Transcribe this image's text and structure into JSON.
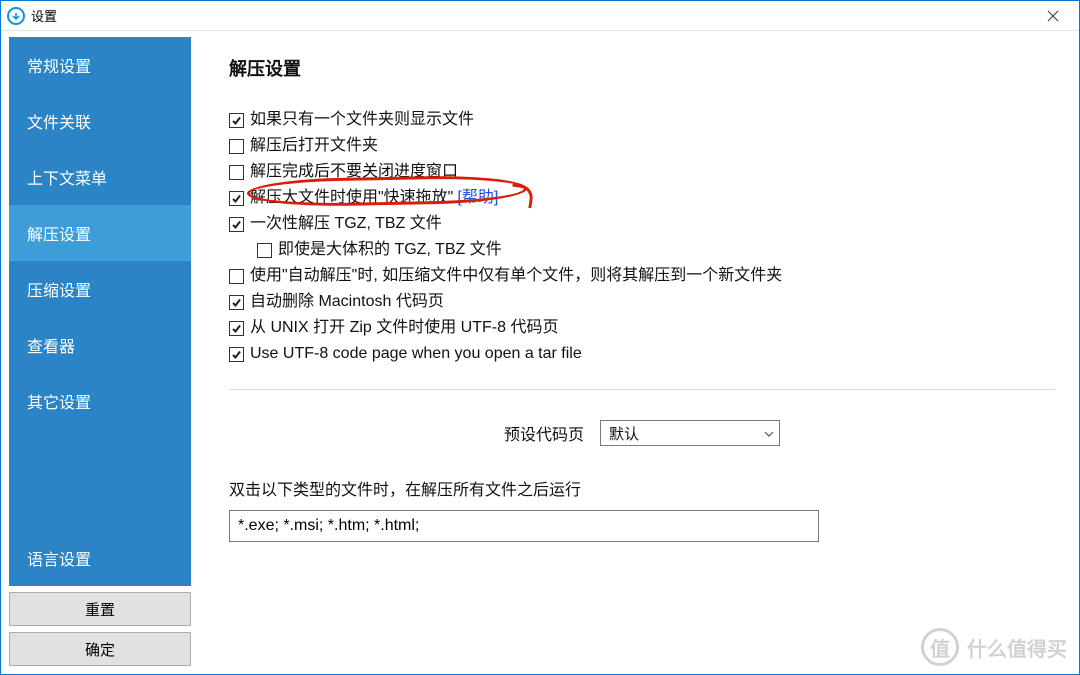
{
  "window": {
    "title": "设置"
  },
  "sidebar": {
    "items": [
      {
        "label": "常规设置"
      },
      {
        "label": "文件关联"
      },
      {
        "label": "上下文菜单"
      },
      {
        "label": "解压设置"
      },
      {
        "label": "压缩设置"
      },
      {
        "label": "查看器"
      },
      {
        "label": "其它设置"
      }
    ],
    "lang_label": "语言设置",
    "reset_label": "重置",
    "ok_label": "确定",
    "active_index": 3
  },
  "main": {
    "heading": "解压设置",
    "options": [
      {
        "checked": true,
        "label": "如果只有一个文件夹则显示文件"
      },
      {
        "checked": false,
        "label": "解压后打开文件夹"
      },
      {
        "checked": false,
        "label": "解压完成后不要关闭进度窗口"
      },
      {
        "checked": true,
        "label": "解压大文件时使用\"快速拖放\"",
        "help": "[帮助]"
      },
      {
        "checked": true,
        "label": "一次性解压 TGZ, TBZ 文件"
      },
      {
        "checked": false,
        "label": "即使是大体积的 TGZ, TBZ 文件",
        "indent": true
      },
      {
        "checked": false,
        "label": "使用\"自动解压\"时, 如压缩文件中仅有单个文件，则将其解压到一个新文件夹"
      },
      {
        "checked": true,
        "label": "自动删除 Macintosh 代码页"
      },
      {
        "checked": true,
        "label": "从 UNIX 打开 Zip 文件时使用 UTF-8 代码页"
      },
      {
        "checked": true,
        "label": "Use UTF-8 code page when you open a tar file"
      }
    ],
    "codepage_label": "预设代码页",
    "codepage_value": "默认",
    "run_after_label": "双击以下类型的文件时，在解压所有文件之后运行",
    "ext_value": "*.exe; *.msi; *.htm; *.html;"
  },
  "watermark": {
    "badge": "值",
    "text": "什么值得买"
  },
  "colors": {
    "accent": "#2a84c6",
    "accent_hi": "#3e9cd9",
    "border": "#0078d7",
    "annot": "#d81e06"
  }
}
